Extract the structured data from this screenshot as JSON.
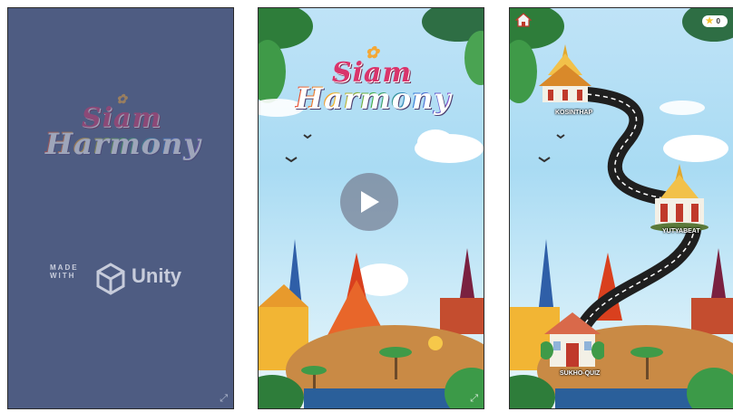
{
  "panels": {
    "splash": {
      "logo_line1": "Siam",
      "logo_line2": "Harmony",
      "made_with": "MADE\nWITH",
      "engine": "Unity"
    },
    "title_screen": {
      "logo_line1": "Siam",
      "logo_line2": "Harmony"
    },
    "map_screen": {
      "star_count": "0",
      "levels": [
        {
          "label": "KOSINTHAP"
        },
        {
          "label": "YUTYABEAT"
        },
        {
          "label": "SUKHO-QUIZ"
        }
      ]
    }
  },
  "icons": {
    "play": "play-icon",
    "home": "home-icon",
    "star": "star-icon",
    "fullscreen": "fullscreen-icon"
  },
  "colors": {
    "splash_bg": "#4e5c82",
    "sky": "#b9e1f5",
    "road": "#1f1f1f",
    "star": "#f4c430"
  }
}
